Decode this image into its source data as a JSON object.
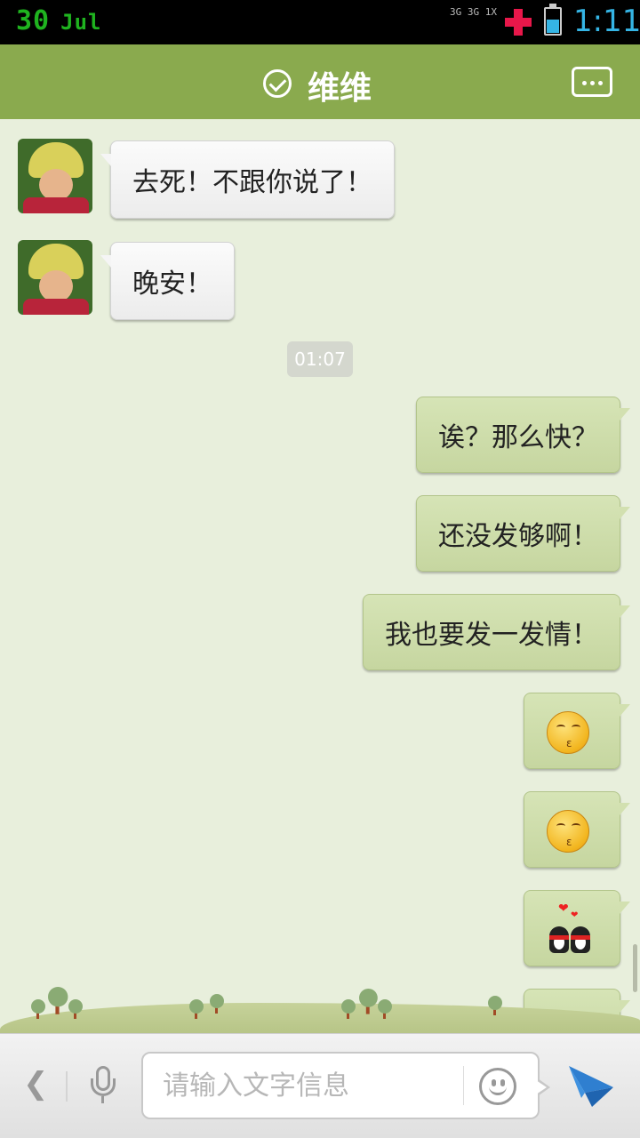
{
  "status_bar": {
    "day": "30",
    "month": "Jul",
    "network_top": "3G 3G 1X",
    "time": "1:11",
    "battery_level": 0.55
  },
  "header": {
    "title": "维维",
    "accent_color": "#8aaa4e"
  },
  "messages": [
    {
      "side": "left",
      "type": "text",
      "text": "去死！不跟你说了！"
    },
    {
      "side": "left",
      "type": "text",
      "text": "晚安！"
    },
    {
      "side": "center",
      "type": "time",
      "text": "01:07"
    },
    {
      "side": "right",
      "type": "text",
      "text": "诶？那么快？"
    },
    {
      "side": "right",
      "type": "text",
      "text": "还没发够啊！"
    },
    {
      "side": "right",
      "type": "text",
      "text": "我也要发一发情！"
    },
    {
      "side": "right",
      "type": "emoji",
      "icon": "kiss-face-emoji"
    },
    {
      "side": "right",
      "type": "emoji",
      "icon": "kiss-face-emoji"
    },
    {
      "side": "right",
      "type": "emoji",
      "icon": "penguins-love-emoji"
    },
    {
      "side": "right",
      "type": "emoji",
      "icon": "penguins-love-emoji"
    }
  ],
  "input_bar": {
    "placeholder": "请输入文字信息",
    "value": ""
  },
  "icons": {
    "back": "chevron-left-icon",
    "voice": "microphone-icon",
    "emoji": "smiley-icon",
    "send": "paper-plane-icon",
    "menu": "chat-menu-icon",
    "verified": "check-circle-icon"
  }
}
